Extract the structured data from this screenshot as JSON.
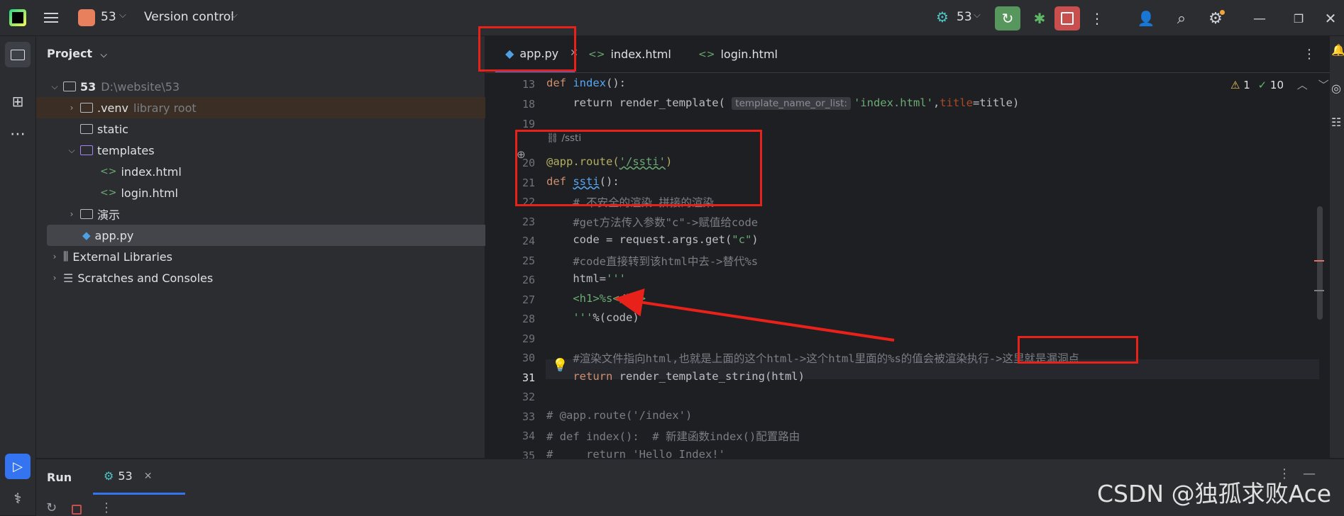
{
  "titlebar": {
    "project_name": "53",
    "vcs_label": "Version control",
    "run_config": "53"
  },
  "project_panel": {
    "title": "Project",
    "tree": [
      {
        "label": "53",
        "hint": "D:\\website\\53"
      },
      {
        "label": ".venv",
        "hint": "library root"
      },
      {
        "label": "static",
        "hint": ""
      },
      {
        "label": "templates",
        "hint": ""
      },
      {
        "label": "index.html",
        "hint": ""
      },
      {
        "label": "login.html",
        "hint": ""
      },
      {
        "label": "演示",
        "hint": ""
      },
      {
        "label": "app.py",
        "hint": ""
      },
      {
        "label": "External Libraries",
        "hint": ""
      },
      {
        "label": "Scratches and Consoles",
        "hint": ""
      }
    ]
  },
  "tabs": [
    {
      "label": "app.py"
    },
    {
      "label": "index.html"
    },
    {
      "label": "login.html"
    }
  ],
  "inspections": {
    "warnings": "1",
    "ok": "10"
  },
  "code": {
    "line_numbers": [
      "13",
      "18",
      "19",
      "20",
      "21",
      "22",
      "23",
      "24",
      "25",
      "26",
      "27",
      "28",
      "29",
      "30",
      "31",
      "32",
      "33",
      "34",
      "35"
    ],
    "route_hint": "/ssti",
    "param_hint": "template_name_or_list:",
    "l13_def": "def ",
    "l13_name": "index",
    "l13_rest": "():",
    "l18_a": "    return render_template( ",
    "l18_str": "'index.html'",
    "l18_b": ",",
    "l18_kw": "title",
    "l18_c": "=title)",
    "l20_dec": "@app.route(",
    "l20_str": "'/ssti'",
    "l20_end": ")",
    "l21_def": "def ",
    "l21_name": "ssti",
    "l21_rest": "():",
    "l22": "    # 不安全的渲染 拼接的渲染",
    "l23": "    #get方法传入参数\"c\"->赋值给code",
    "l24_a": "    code = request.args.get(",
    "l24_str": "\"c\"",
    "l24_b": ")",
    "l25": "    #code直接转到该html中去->替代%s",
    "l26_a": "    html=",
    "l26_str": "'''",
    "l27": "    <h1>%s</h1>",
    "l28_str": "    '''",
    "l28_b": "%(code)",
    "l30": "    #渲染文件指向html,也就是上面的这个html->这个html里面的%s的值会被渲染执行->这里就是漏洞点",
    "l31_kw": "    return ",
    "l31_b": "render_template_string(html)",
    "l33": "# @app.route('/index')",
    "l34": "# def index():  # 新建函数index()配置路由",
    "l35": "#     return 'Hello Index!'"
  },
  "run_panel": {
    "title": "Run",
    "tab_label": "53"
  },
  "watermark": "CSDN @独孤求败Ace",
  "colors": {
    "accent": "#3574f0",
    "annotation": "#e8211a",
    "run_green": "#57965c",
    "stop_red": "#c94f4f"
  }
}
